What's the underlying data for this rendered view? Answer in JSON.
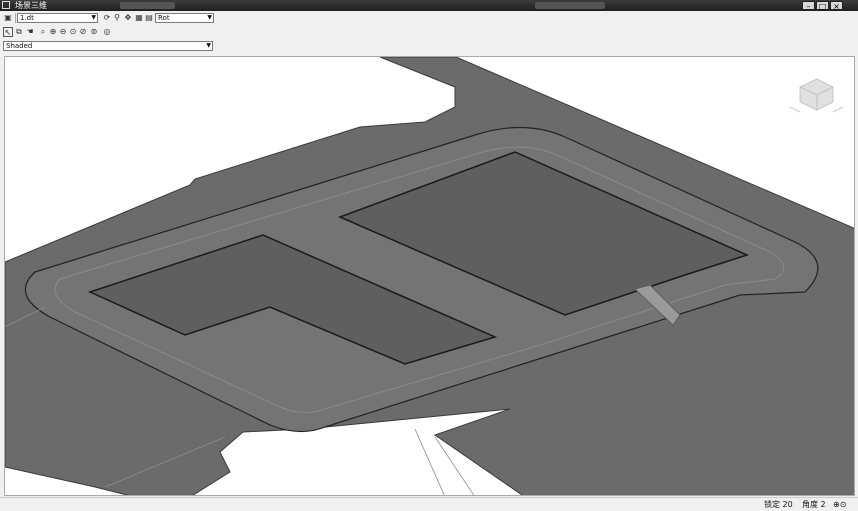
{
  "window": {
    "title": "场景三维",
    "controls": {
      "minimize": "–",
      "maximize": "□",
      "close": "×"
    }
  },
  "toolbar1": {
    "layer_combo_value": "1.dt",
    "view_combo_value": "Rot"
  },
  "toolbar3": {
    "style_combo_value": "Shaded"
  },
  "icons": [
    "save-icon",
    "rotate-icon",
    "pan-icon",
    "zoom-icon",
    "zoom-window-icon",
    "zoom-in-icon",
    "zoom-out-icon",
    "zoom-extents-icon",
    "zoom-previous-icon",
    "orbit-icon",
    "view-cube-icon"
  ],
  "colors": {
    "surface": "#6b6b6b",
    "pad": "#5f5f5f",
    "viewport_bg": "#ffffff"
  },
  "status": {
    "item1": "锁定 20",
    "item2": "角度 2",
    "item3": "⊕⊙"
  }
}
